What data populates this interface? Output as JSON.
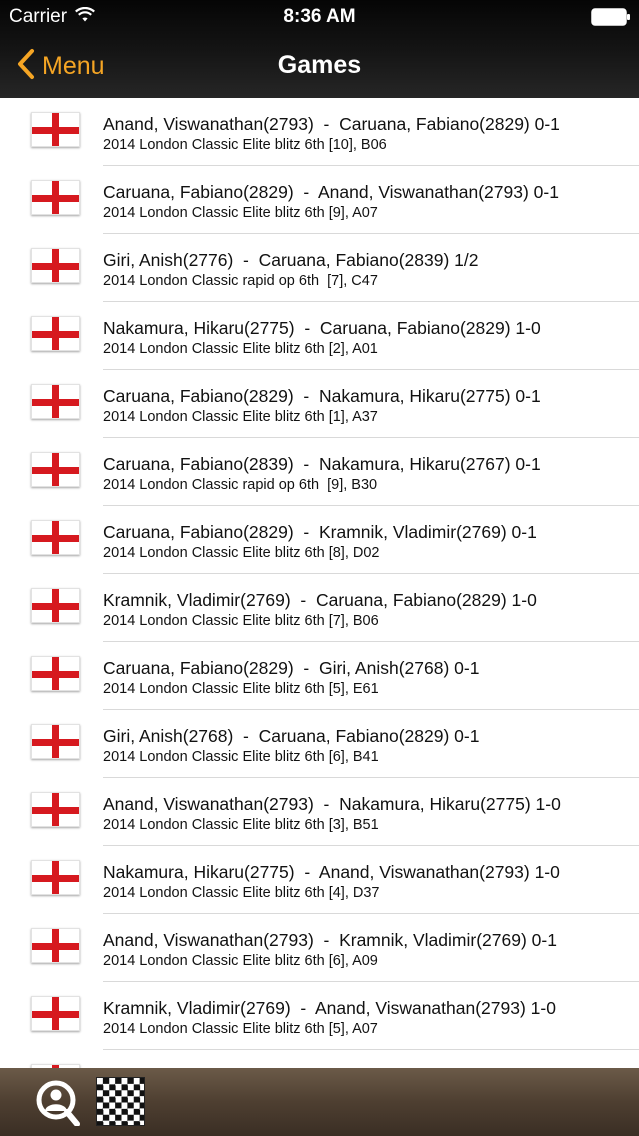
{
  "status": {
    "carrier": "Carrier",
    "time": "8:36 AM"
  },
  "nav": {
    "back_label": "Menu",
    "title": "Games"
  },
  "games": [
    {
      "title": "Anand, Viswanathan(2793)  -  Caruana, Fabiano(2829) 0-1",
      "subtitle": "2014 London Classic Elite blitz 6th [10], B06"
    },
    {
      "title": "Caruana, Fabiano(2829)  -  Anand, Viswanathan(2793) 0-1",
      "subtitle": "2014 London Classic Elite blitz 6th [9], A07"
    },
    {
      "title": "Giri, Anish(2776)  -  Caruana, Fabiano(2839) 1/2",
      "subtitle": "2014 London Classic rapid op 6th  [7], C47"
    },
    {
      "title": "Nakamura, Hikaru(2775)  -  Caruana, Fabiano(2829) 1-0",
      "subtitle": "2014 London Classic Elite blitz 6th [2], A01"
    },
    {
      "title": "Caruana, Fabiano(2829)  -  Nakamura, Hikaru(2775) 0-1",
      "subtitle": "2014 London Classic Elite blitz 6th [1], A37"
    },
    {
      "title": "Caruana, Fabiano(2839)  -  Nakamura, Hikaru(2767) 0-1",
      "subtitle": "2014 London Classic rapid op 6th  [9], B30"
    },
    {
      "title": "Caruana, Fabiano(2829)  -  Kramnik, Vladimir(2769) 0-1",
      "subtitle": "2014 London Classic Elite blitz 6th [8], D02"
    },
    {
      "title": "Kramnik, Vladimir(2769)  -  Caruana, Fabiano(2829) 1-0",
      "subtitle": "2014 London Classic Elite blitz 6th [7], B06"
    },
    {
      "title": "Caruana, Fabiano(2829)  -  Giri, Anish(2768) 0-1",
      "subtitle": "2014 London Classic Elite blitz 6th [5], E61"
    },
    {
      "title": "Giri, Anish(2768)  -  Caruana, Fabiano(2829) 0-1",
      "subtitle": "2014 London Classic Elite blitz 6th [6], B41"
    },
    {
      "title": "Anand, Viswanathan(2793)  -  Nakamura, Hikaru(2775) 1-0",
      "subtitle": "2014 London Classic Elite blitz 6th [3], B51"
    },
    {
      "title": "Nakamura, Hikaru(2775)  -  Anand, Viswanathan(2793) 1-0",
      "subtitle": "2014 London Classic Elite blitz 6th [4], D37"
    },
    {
      "title": "Anand, Viswanathan(2793)  -  Kramnik, Vladimir(2769) 0-1",
      "subtitle": "2014 London Classic Elite blitz 6th [6], A09"
    },
    {
      "title": "Kramnik, Vladimir(2769)  -  Anand, Viswanathan(2793) 1-0",
      "subtitle": "2014 London Classic Elite blitz 6th [5], A07"
    }
  ],
  "colors": {
    "accent": "#f5a524",
    "flag_red": "#d6191f",
    "toolbar": "#4e3f31"
  },
  "icons": {
    "flag": "england-flag-icon",
    "search": "player-search-icon",
    "board": "chessboard-icon"
  }
}
